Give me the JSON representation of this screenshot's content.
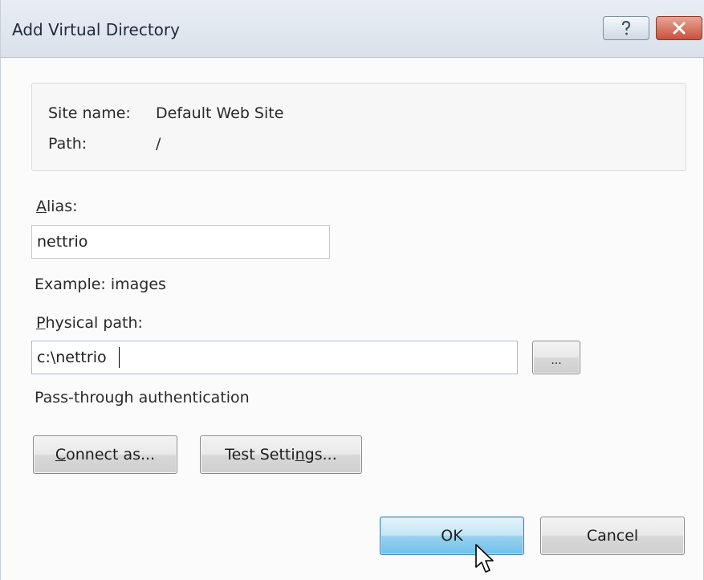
{
  "window": {
    "title": "Add Virtual Directory",
    "help_glyph": "?",
    "close_glyph": "×"
  },
  "info": {
    "site_name_label": "Site name:",
    "site_name_value": "Default Web Site",
    "path_label": "Path:",
    "path_value": "/"
  },
  "alias": {
    "label_mnemonic": "A",
    "label_rest": "lias:",
    "value": "nettrio",
    "example": "Example: images"
  },
  "physical_path": {
    "label_mnemonic": "P",
    "label_rest": "hysical path:",
    "value": "c:\\nettrio",
    "browse_label": "..."
  },
  "auth": {
    "text": "Pass-through authentication"
  },
  "buttons": {
    "connect_as_mnemonic": "C",
    "connect_as_rest": "onnect as...",
    "test_settings_pre": "Test Setti",
    "test_settings_mnemonic": "n",
    "test_settings_post": "gs...",
    "ok": "OK",
    "cancel": "Cancel"
  },
  "icons": {
    "help": "help-icon",
    "close": "close-icon",
    "cursor": "arrow-cursor-icon"
  },
  "colors": {
    "default_button": "#98d1ef",
    "close_button": "#c8513b"
  }
}
